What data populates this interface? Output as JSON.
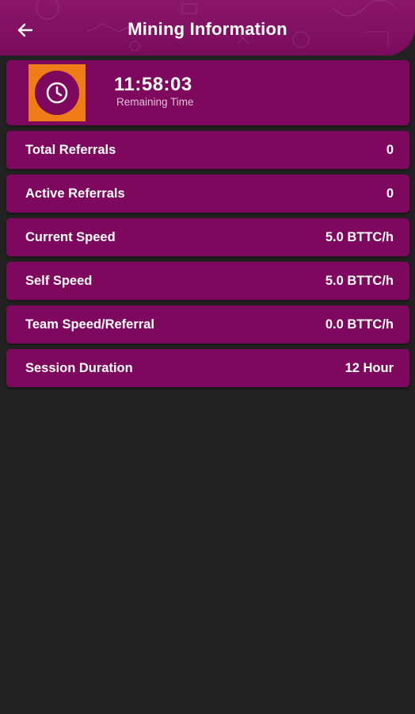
{
  "header": {
    "title": "Mining Information"
  },
  "timer": {
    "value": "11:58:03",
    "label": "Remaining Time"
  },
  "stats": [
    {
      "label": "Total Referrals",
      "value": "0"
    },
    {
      "label": "Active Referrals",
      "value": "0"
    },
    {
      "label": "Current Speed",
      "value": "5.0 BTTC/h"
    },
    {
      "label": "Self Speed",
      "value": "5.0 BTTC/h"
    },
    {
      "label": "Team Speed/Referral",
      "value": "0.0 BTTC/h"
    },
    {
      "label": "Session Duration",
      "value": "12 Hour"
    }
  ],
  "colors": {
    "header": "#7a0c5c",
    "card": "#7f085f",
    "accent": "#f07c17",
    "background": "#222222"
  },
  "icons": {
    "back": "arrow-left-icon",
    "timer": "clock-icon"
  }
}
